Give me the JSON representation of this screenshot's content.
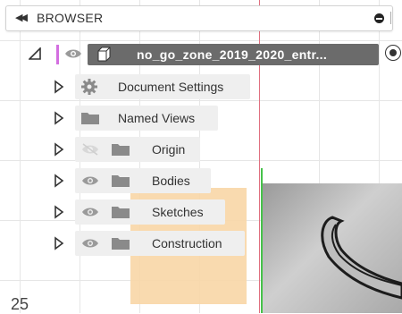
{
  "browser": {
    "title": "BROWSER"
  },
  "root": {
    "label": "no_go_zone_2019_2020_entr..."
  },
  "items": [
    {
      "label": "Document Settings",
      "icon": "gear-icon"
    },
    {
      "label": "Named Views",
      "icon": "folder-icon"
    },
    {
      "label": "Origin",
      "icon": "folder-icon",
      "visibility": "hidden"
    },
    {
      "label": "Bodies",
      "icon": "folder-icon",
      "visibility": "visible"
    },
    {
      "label": "Sketches",
      "icon": "folder-icon",
      "visibility": "visible"
    },
    {
      "label": "Construction",
      "icon": "folder-icon",
      "visibility": "visible"
    }
  ],
  "page_number": "25",
  "colors": {
    "root_accent": "#d36ee0",
    "root_background": "#6b6b6b",
    "red_axis": "#e07080",
    "green_axis": "#46c24a",
    "sketch_fill": "#f8d6a6"
  }
}
